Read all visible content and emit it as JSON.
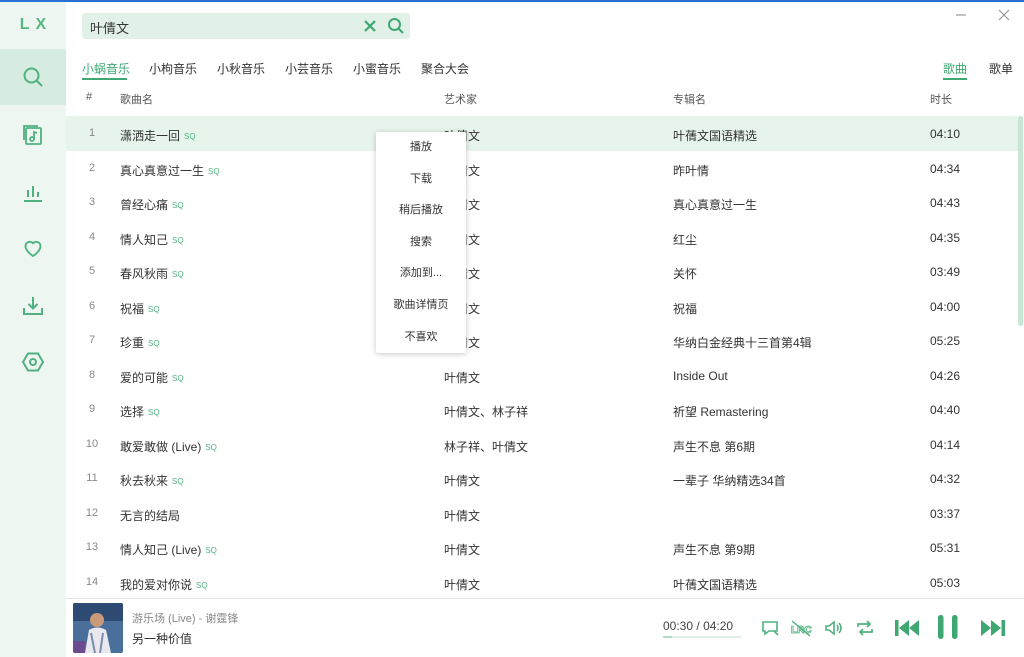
{
  "app": {
    "logo": "LX"
  },
  "colors": {
    "accent": "#3fa872",
    "accent_light": "#e6f4ec",
    "sidebar_bg": "#eef6f1"
  },
  "sidebar": {
    "items": [
      {
        "icon": "search-icon",
        "active": true
      },
      {
        "icon": "song-list-icon",
        "active": false
      },
      {
        "icon": "leaderboard-icon",
        "active": false
      },
      {
        "icon": "heart-icon",
        "active": false
      },
      {
        "icon": "download-icon",
        "active": false
      },
      {
        "icon": "settings-icon",
        "active": false
      }
    ]
  },
  "search": {
    "value": "叶倩文",
    "placeholder": ""
  },
  "sources": [
    "小蜗音乐",
    "小枸音乐",
    "小秋音乐",
    "小芸音乐",
    "小蜜音乐",
    "聚合大会"
  ],
  "source_active": 0,
  "types": [
    "歌曲",
    "歌单"
  ],
  "type_active": 0,
  "table": {
    "headers": {
      "index": "#",
      "name": "歌曲名",
      "artist": "艺术家",
      "album": "专辑名",
      "duration": "时长"
    },
    "rows": [
      {
        "index": "1",
        "name": "潇洒走一回",
        "sq": "SQ",
        "artist": "叶倩文",
        "album": "叶蒨文国语精选",
        "duration": "04:10"
      },
      {
        "index": "2",
        "name": "真心真意过一生",
        "sq": "SQ",
        "artist": "叶倩文",
        "album": "昨叶情",
        "duration": "04:34"
      },
      {
        "index": "3",
        "name": "曾经心痛",
        "sq": "SQ",
        "artist": "叶倩文",
        "album": "真心真意过一生",
        "duration": "04:43"
      },
      {
        "index": "4",
        "name": "情人知己",
        "sq": "SQ",
        "artist": "叶倩文",
        "album": "红尘",
        "duration": "04:35"
      },
      {
        "index": "5",
        "name": "春风秋雨",
        "sq": "SQ",
        "artist": "叶倩文",
        "album": "关怀",
        "duration": "03:49"
      },
      {
        "index": "6",
        "name": "祝福",
        "sq": "SQ",
        "artist": "叶倩文",
        "album": "祝福",
        "duration": "04:00"
      },
      {
        "index": "7",
        "name": "珍重",
        "sq": "SQ",
        "artist": "叶倩文",
        "album": "华纳白金经典十三首第4辑",
        "duration": "05:25"
      },
      {
        "index": "8",
        "name": "爱的可能",
        "sq": "SQ",
        "artist": "叶倩文",
        "album": "Inside Out",
        "duration": "04:26"
      },
      {
        "index": "9",
        "name": "选择",
        "sq": "SQ",
        "artist": "叶倩文、林子祥",
        "album": "祈望 Remastering",
        "duration": "04:40"
      },
      {
        "index": "10",
        "name": "敢爱敢做 (Live)",
        "sq": "SQ",
        "artist": "林子祥、叶倩文",
        "album": "声生不息 第6期",
        "duration": "04:14"
      },
      {
        "index": "11",
        "name": "秋去秋来",
        "sq": "SQ",
        "artist": "叶倩文",
        "album": "一辈子 华纳精选34首",
        "duration": "04:32"
      },
      {
        "index": "12",
        "name": "无言的结局",
        "sq": "",
        "artist": "叶倩文",
        "album": "",
        "duration": "03:37"
      },
      {
        "index": "13",
        "name": "情人知己 (Live)",
        "sq": "SQ",
        "artist": "叶倩文",
        "album": "声生不息 第9期",
        "duration": "05:31"
      },
      {
        "index": "14",
        "name": "我的爱对你说",
        "sq": "SQ",
        "artist": "叶倩文",
        "album": "叶蒨文国语精选",
        "duration": "05:03"
      }
    ]
  },
  "context_menu": {
    "items": [
      "播放",
      "下载",
      "稍后播放",
      "搜索",
      "添加到...",
      "歌曲详情页",
      "不喜欢"
    ]
  },
  "player": {
    "subtitle": "游乐场 (Live) - 谢霆锋",
    "title": "另一种价值",
    "current_time": "00:30",
    "separator": "/",
    "total_time": "04:20",
    "progress": 0.115,
    "controls": [
      "comment-icon",
      "lyrics-icon",
      "volume-icon",
      "loop-icon",
      "previous-icon",
      "pause-icon",
      "next-icon"
    ]
  }
}
